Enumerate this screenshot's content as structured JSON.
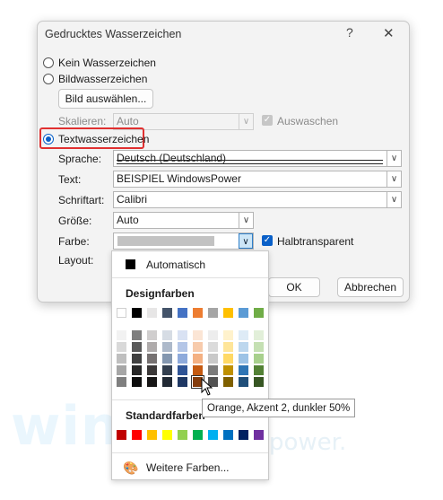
{
  "watermark": {
    "big": "win",
    "small": "power."
  },
  "dialog": {
    "title": "Gedrucktes Wasserzeichen",
    "help": "?",
    "close": "✕",
    "options": {
      "none": "Kein Wasserzeichen",
      "picture": "Bildwasserzeichen",
      "text": "Textwasserzeichen"
    },
    "picture": {
      "select_button": "Bild auswählen...",
      "scale_label": "Skalieren:",
      "scale_value": "Auto",
      "washout_label": "Auswaschen"
    },
    "text": {
      "language_label": "Sprache:",
      "language_value": "Deutsch (Deutschland)",
      "text_label": "Text:",
      "text_value": "BEISPIEL WindowsPower",
      "font_label": "Schriftart:",
      "font_value": "Calibri",
      "size_label": "Größe:",
      "size_value": "Auto",
      "color_label": "Farbe:",
      "semitransparent_label": "Halbtransparent",
      "layout_label": "Layout:"
    },
    "ok": "OK",
    "cancel": "Abbrechen"
  },
  "palette": {
    "automatic": "Automatisch",
    "theme_header": "Designfarben",
    "standard_header": "Standardfarben",
    "more_colors": "Weitere Farben...",
    "theme_colors": [
      [
        "#ffffff",
        "#f2f2f2",
        "#d9d9d9",
        "#bfbfbf",
        "#a6a6a6",
        "#7f7f7f"
      ],
      [
        "#000000",
        "#7f7f7f",
        "#595959",
        "#404040",
        "#262626",
        "#0d0d0d"
      ],
      [
        "#e7e6e6",
        "#d0cece",
        "#afabab",
        "#767171",
        "#3b3838",
        "#171616"
      ],
      [
        "#44546a",
        "#d6dce4",
        "#adb9ca",
        "#8497b0",
        "#333f4f",
        "#222a35"
      ],
      [
        "#4472c4",
        "#d9e2f3",
        "#b4c6e7",
        "#8eaadb",
        "#2f5496",
        "#1f3864"
      ],
      [
        "#ed7d31",
        "#fbe5d5",
        "#f7cbac",
        "#f4b183",
        "#c55a11",
        "#843c0c"
      ],
      [
        "#a5a5a5",
        "#ededed",
        "#dbdbdb",
        "#c9c9c9",
        "#7b7b7b",
        "#525252"
      ],
      [
        "#ffc000",
        "#fff2cc",
        "#fee599",
        "#ffd965",
        "#bf9000",
        "#7f6000"
      ],
      [
        "#5b9bd5",
        "#deebf6",
        "#bdd7ee",
        "#9dc3e6",
        "#2e75b5",
        "#1f4e79"
      ],
      [
        "#70ad47",
        "#e2efd9",
        "#c5e0b3",
        "#a8d08d",
        "#538135",
        "#375623"
      ]
    ],
    "standard_colors": [
      "#c00000",
      "#ff0000",
      "#ffc000",
      "#ffff00",
      "#92d050",
      "#00b050",
      "#00b0f0",
      "#0070c0",
      "#002060",
      "#7030a0"
    ],
    "tooltip": "Orange, Akzent 2, dunkler 50%"
  }
}
